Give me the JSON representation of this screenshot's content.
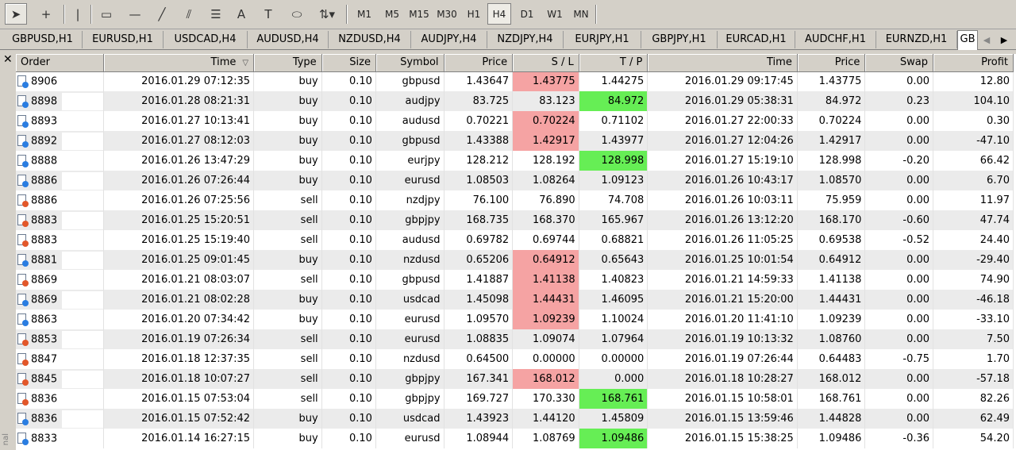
{
  "toolbar": {
    "tools": [
      {
        "name": "cursor-icon",
        "glyph": "➤"
      },
      {
        "name": "crosshair-icon",
        "glyph": "+"
      },
      {
        "name": "vertical-line-icon",
        "glyph": "|"
      },
      {
        "name": "rectangle-icon",
        "glyph": "▭"
      },
      {
        "name": "horizontal-line-icon",
        "glyph": "—"
      },
      {
        "name": "trendline-icon",
        "glyph": "╱"
      },
      {
        "name": "equidistant-channel-icon",
        "glyph": "⫽"
      },
      {
        "name": "fibonacci-icon",
        "glyph": "☰"
      },
      {
        "name": "text-icon",
        "glyph": "A"
      },
      {
        "name": "text-label-icon",
        "glyph": "T"
      },
      {
        "name": "ellipse-icon",
        "glyph": "⬭"
      },
      {
        "name": "arrows-dropdown-icon",
        "glyph": "⇅▾"
      }
    ],
    "timeframes": [
      "M1",
      "M5",
      "M15",
      "M30",
      "H1",
      "H4",
      "D1",
      "W1",
      "MN"
    ],
    "active_timeframe": "H4"
  },
  "tabs": [
    "GBPUSD,H1",
    "EURUSD,H1",
    "USDCAD,H4",
    "AUDUSD,H4",
    "NZDUSD,H4",
    "AUDJPY,H4",
    "NZDJPY,H4",
    "EURJPY,H1",
    "GBPJPY,H1",
    "EURCAD,H1",
    "AUDCHF,H1",
    "EURNZD,H1",
    "GB"
  ],
  "active_tab_index": 12,
  "side_label": "nal",
  "columns": [
    "Order",
    "Time",
    "Type",
    "Size",
    "Symbol",
    "Price",
    "S / L",
    "T / P",
    "Time",
    "Price",
    "Swap",
    "Profit"
  ],
  "sort_indicator": "▽",
  "rows": [
    {
      "order": "8906",
      "open_time": "2016.01.29 07:12:35",
      "type": "buy",
      "size": "0.10",
      "symbol": "gbpusd",
      "price": "1.43647",
      "sl": "1.43775",
      "tp": "1.44275",
      "close_time": "2016.01.29 09:17:45",
      "close_price": "1.43775",
      "swap": "0.00",
      "profit": "12.80",
      "hl": "sl"
    },
    {
      "order": "8898",
      "open_time": "2016.01.28 08:21:31",
      "type": "buy",
      "size": "0.10",
      "symbol": "audjpy",
      "price": "83.725",
      "sl": "83.123",
      "tp": "84.972",
      "close_time": "2016.01.29 05:38:31",
      "close_price": "84.972",
      "swap": "0.23",
      "profit": "104.10",
      "hl": "tp"
    },
    {
      "order": "8893",
      "open_time": "2016.01.27 10:13:41",
      "type": "buy",
      "size": "0.10",
      "symbol": "audusd",
      "price": "0.70221",
      "sl": "0.70224",
      "tp": "0.71102",
      "close_time": "2016.01.27 22:00:33",
      "close_price": "0.70224",
      "swap": "0.00",
      "profit": "0.30",
      "hl": "sl"
    },
    {
      "order": "8892",
      "open_time": "2016.01.27 08:12:03",
      "type": "buy",
      "size": "0.10",
      "symbol": "gbpusd",
      "price": "1.43388",
      "sl": "1.42917",
      "tp": "1.43977",
      "close_time": "2016.01.27 12:04:26",
      "close_price": "1.42917",
      "swap": "0.00",
      "profit": "-47.10",
      "hl": "sl"
    },
    {
      "order": "8888",
      "open_time": "2016.01.26 13:47:29",
      "type": "buy",
      "size": "0.10",
      "symbol": "eurjpy",
      "price": "128.212",
      "sl": "128.192",
      "tp": "128.998",
      "close_time": "2016.01.27 15:19:10",
      "close_price": "128.998",
      "swap": "-0.20",
      "profit": "66.42",
      "hl": "tp"
    },
    {
      "order": "8886",
      "open_time": "2016.01.26 07:26:44",
      "type": "buy",
      "size": "0.10",
      "symbol": "eurusd",
      "price": "1.08503",
      "sl": "1.08264",
      "tp": "1.09123",
      "close_time": "2016.01.26 10:43:17",
      "close_price": "1.08570",
      "swap": "0.00",
      "profit": "6.70",
      "hl": ""
    },
    {
      "order": "8886",
      "open_time": "2016.01.26 07:25:56",
      "type": "sell",
      "size": "0.10",
      "symbol": "nzdjpy",
      "price": "76.100",
      "sl": "76.890",
      "tp": "74.708",
      "close_time": "2016.01.26 10:03:11",
      "close_price": "75.959",
      "swap": "0.00",
      "profit": "11.97",
      "hl": ""
    },
    {
      "order": "8883",
      "open_time": "2016.01.25 15:20:51",
      "type": "sell",
      "size": "0.10",
      "symbol": "gbpjpy",
      "price": "168.735",
      "sl": "168.370",
      "tp": "165.967",
      "close_time": "2016.01.26 13:12:20",
      "close_price": "168.170",
      "swap": "-0.60",
      "profit": "47.74",
      "hl": ""
    },
    {
      "order": "8883",
      "open_time": "2016.01.25 15:19:40",
      "type": "sell",
      "size": "0.10",
      "symbol": "audusd",
      "price": "0.69782",
      "sl": "0.69744",
      "tp": "0.68821",
      "close_time": "2016.01.26 11:05:25",
      "close_price": "0.69538",
      "swap": "-0.52",
      "profit": "24.40",
      "hl": ""
    },
    {
      "order": "8881",
      "open_time": "2016.01.25 09:01:45",
      "type": "buy",
      "size": "0.10",
      "symbol": "nzdusd",
      "price": "0.65206",
      "sl": "0.64912",
      "tp": "0.65643",
      "close_time": "2016.01.25 10:01:54",
      "close_price": "0.64912",
      "swap": "0.00",
      "profit": "-29.40",
      "hl": "sl"
    },
    {
      "order": "8869",
      "open_time": "2016.01.21 08:03:07",
      "type": "sell",
      "size": "0.10",
      "symbol": "gbpusd",
      "price": "1.41887",
      "sl": "1.41138",
      "tp": "1.40823",
      "close_time": "2016.01.21 14:59:33",
      "close_price": "1.41138",
      "swap": "0.00",
      "profit": "74.90",
      "hl": "sl"
    },
    {
      "order": "8869",
      "open_time": "2016.01.21 08:02:28",
      "type": "buy",
      "size": "0.10",
      "symbol": "usdcad",
      "price": "1.45098",
      "sl": "1.44431",
      "tp": "1.46095",
      "close_time": "2016.01.21 15:20:00",
      "close_price": "1.44431",
      "swap": "0.00",
      "profit": "-46.18",
      "hl": "sl"
    },
    {
      "order": "8863",
      "open_time": "2016.01.20 07:34:42",
      "type": "buy",
      "size": "0.10",
      "symbol": "eurusd",
      "price": "1.09570",
      "sl": "1.09239",
      "tp": "1.10024",
      "close_time": "2016.01.20 11:41:10",
      "close_price": "1.09239",
      "swap": "0.00",
      "profit": "-33.10",
      "hl": "sl"
    },
    {
      "order": "8853",
      "open_time": "2016.01.19 07:26:34",
      "type": "sell",
      "size": "0.10",
      "symbol": "eurusd",
      "price": "1.08835",
      "sl": "1.09074",
      "tp": "1.07964",
      "close_time": "2016.01.19 10:13:32",
      "close_price": "1.08760",
      "swap": "0.00",
      "profit": "7.50",
      "hl": ""
    },
    {
      "order": "8847",
      "open_time": "2016.01.18 12:37:35",
      "type": "sell",
      "size": "0.10",
      "symbol": "nzdusd",
      "price": "0.64500",
      "sl": "0.00000",
      "tp": "0.00000",
      "close_time": "2016.01.19 07:26:44",
      "close_price": "0.64483",
      "swap": "-0.75",
      "profit": "1.70",
      "hl": ""
    },
    {
      "order": "8845",
      "open_time": "2016.01.18 10:07:27",
      "type": "sell",
      "size": "0.10",
      "symbol": "gbpjpy",
      "price": "167.341",
      "sl": "168.012",
      "tp": "0.000",
      "close_time": "2016.01.18 10:28:27",
      "close_price": "168.012",
      "swap": "0.00",
      "profit": "-57.18",
      "hl": "sl"
    },
    {
      "order": "8836",
      "open_time": "2016.01.15 07:53:04",
      "type": "sell",
      "size": "0.10",
      "symbol": "gbpjpy",
      "price": "169.727",
      "sl": "170.330",
      "tp": "168.761",
      "close_time": "2016.01.15 10:58:01",
      "close_price": "168.761",
      "swap": "0.00",
      "profit": "82.26",
      "hl": "tp"
    },
    {
      "order": "8836",
      "open_time": "2016.01.15 07:52:42",
      "type": "buy",
      "size": "0.10",
      "symbol": "usdcad",
      "price": "1.43923",
      "sl": "1.44120",
      "tp": "1.45809",
      "close_time": "2016.01.15 13:59:46",
      "close_price": "1.44828",
      "swap": "0.00",
      "profit": "62.49",
      "hl": ""
    },
    {
      "order": "8833",
      "open_time": "2016.01.14 16:27:15",
      "type": "buy",
      "size": "0.10",
      "symbol": "eurusd",
      "price": "1.08944",
      "sl": "1.08769",
      "tp": "1.09486",
      "close_time": "2016.01.15 15:38:25",
      "close_price": "1.09486",
      "swap": "-0.36",
      "profit": "54.20",
      "hl": "tp"
    }
  ],
  "colors": {
    "sl_highlight": "#f5a3a3",
    "tp_highlight": "#66ee55",
    "buy_icon": "#2a7de1",
    "sell_icon": "#e2572a",
    "alt_row": "#ebebeb"
  }
}
